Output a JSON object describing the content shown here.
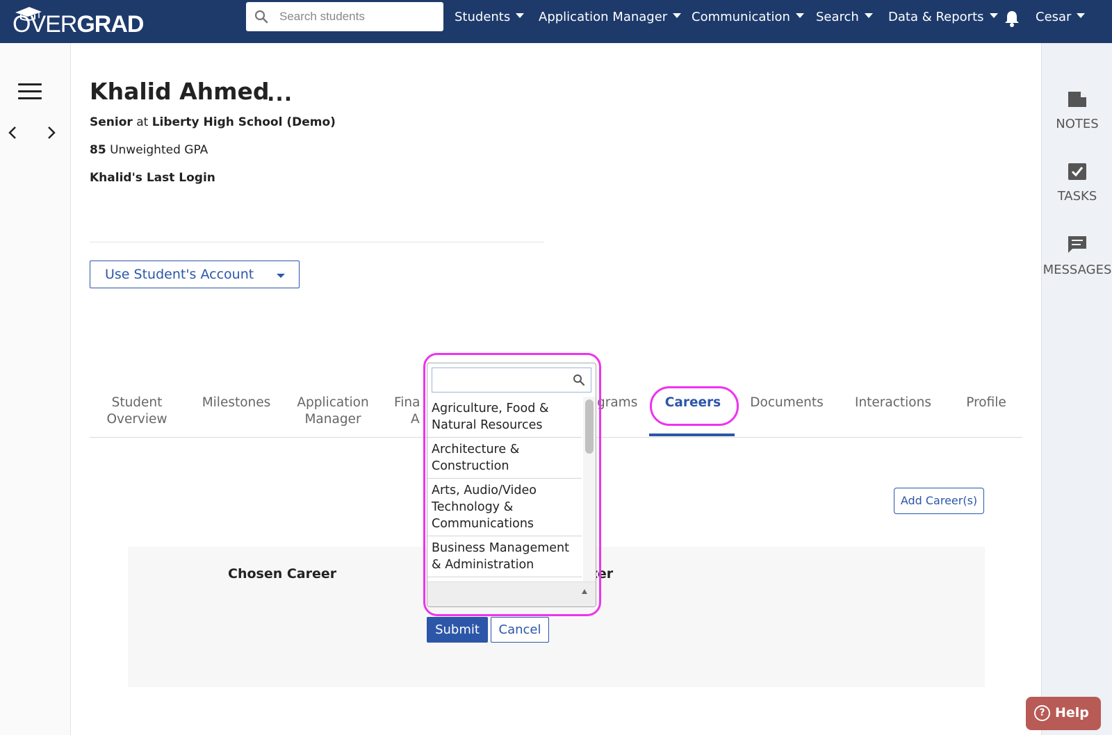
{
  "header": {
    "logo_text_thin": "OVER",
    "logo_text_bold": "GRAD",
    "search_placeholder": "Search students",
    "nav": [
      {
        "label": "Students"
      },
      {
        "label": "Application Manager"
      },
      {
        "label": "Communication"
      },
      {
        "label": "Search"
      },
      {
        "label": "Data & Reports"
      }
    ],
    "user": "Cesar",
    "bar_color": "#1d3a6b"
  },
  "student": {
    "name": "Khalid Ahmed",
    "more": "...",
    "grade": "Senior",
    "at": "at",
    "school": "Liberty High School (Demo)",
    "gpa_value": "85",
    "gpa_label": "Unweighted GPA",
    "last_login": "Khalid's Last Login",
    "account_button": "Use Student's Account"
  },
  "tabs": [
    {
      "line1": "Student",
      "line2": "Overview"
    },
    {
      "line1": "Milestones",
      "line2": ""
    },
    {
      "line1": "Application",
      "line2": "Manager"
    },
    {
      "line1": "Fina",
      "line2": "A"
    },
    {
      "line1": "grams",
      "line2": ""
    },
    {
      "line1": "Careers",
      "line2": "",
      "active": true
    },
    {
      "line1": "Documents",
      "line2": ""
    },
    {
      "line1": "Interactions",
      "line2": ""
    },
    {
      "line1": "Profile",
      "line2": ""
    }
  ],
  "careers": {
    "add_button": "Add Career(s)",
    "chosen_career_header": "Chosen Career",
    "cluster_header": "uster",
    "submit": "Submit",
    "cancel": "Cancel",
    "dropdown_search_value": "",
    "dropdown_options": [
      "Agriculture, Food & Natural Resources",
      "Architecture & Construction",
      "Arts, Audio/Video Technology & Communications",
      "Business Management & Administration"
    ]
  },
  "right_rail": {
    "notes": "NOTES",
    "tasks": "TASKS",
    "messages": "MESSAGES"
  },
  "help": {
    "label": "Help",
    "icon": "?"
  },
  "colors": {
    "accent": "#2c56a8",
    "highlight": "#ee33ee",
    "help_bg": "#b85a55"
  }
}
